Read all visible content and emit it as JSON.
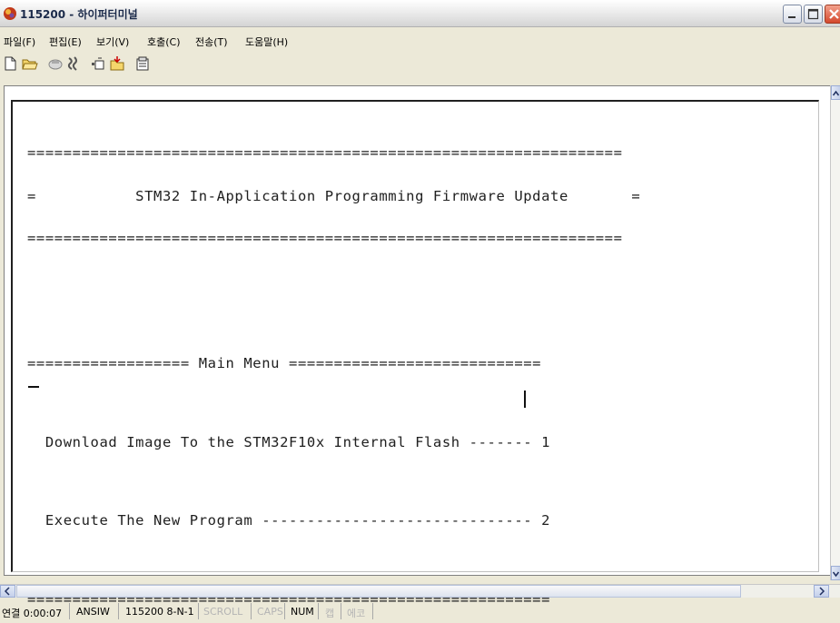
{
  "window": {
    "title": "115200 - 하이퍼터미널",
    "icon": "hyperterminal-app-icon",
    "controls": [
      "minimize-icon",
      "maximize-icon",
      "close-icon"
    ]
  },
  "menu": [
    {
      "label": "파일(F)"
    },
    {
      "label": "편집(E)"
    },
    {
      "label": "보기(V)"
    },
    {
      "label": "호출(C)"
    },
    {
      "label": "전송(T)"
    },
    {
      "label": "도움말(H)"
    }
  ],
  "toolbar": {
    "icons": [
      "new-file-icon",
      "open-folder-icon",
      "call-icon",
      "disconnect-icon",
      "send-icon",
      "receive-icon",
      "properties-icon"
    ]
  },
  "terminal": {
    "lines": [
      "==================================================================",
      "=           STM32 In-Application Programming Firmware Update       =",
      "==================================================================",
      "",
      "",
      "================== Main Menu ============================",
      "",
      "  Download Image To the STM32F10x Internal Flash ------- 1",
      "",
      "  Execute The New Program ------------------------------ 2",
      "",
      "=========================================================="
    ]
  },
  "status": {
    "connection": "연결 0:00:07",
    "emulation": "ANSIW",
    "port_settings": "115200 8-N-1",
    "scroll": "SCROLL",
    "caps": "CAPS",
    "num": "NUM",
    "capture": "캡",
    "echo": "에코"
  }
}
